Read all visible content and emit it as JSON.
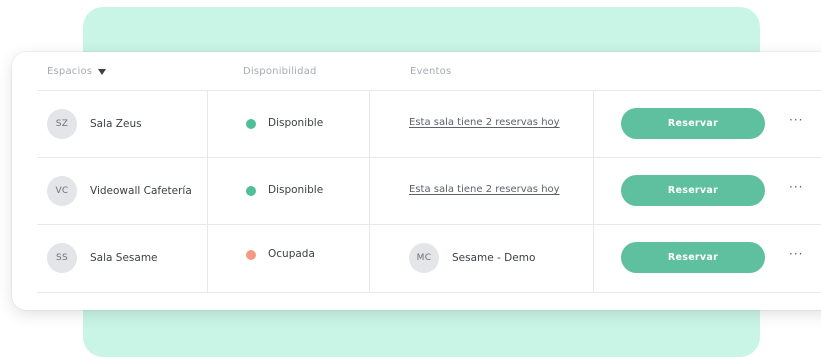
{
  "header": {
    "espacios": "Espacios",
    "disponibilidad": "Disponibilidad",
    "eventos": "Eventos"
  },
  "colors": {
    "accent": "#5ec09e",
    "available_dot": "#4fbf9a",
    "occupied_dot": "#f59a82",
    "background_panel": "#c9f5e6"
  },
  "rows": [
    {
      "initials": "SZ",
      "name": "Sala Zeus",
      "status": "Disponible",
      "status_type": "available",
      "event_link": "Esta sala tiene 2 reservas hoy",
      "button": "Reservar",
      "more": "···"
    },
    {
      "initials": "VC",
      "name": "Videowall Cafetería",
      "status": "Disponible",
      "status_type": "available",
      "event_link": "Esta sala tiene 2 reservas hoy",
      "button": "Reservar",
      "more": "···"
    },
    {
      "initials": "SS",
      "name": "Sala Sesame",
      "status": "Ocupada",
      "status_type": "occupied",
      "event_initials": "MC",
      "event_name": "Sesame - Demo",
      "button": "Reservar",
      "more": "···"
    }
  ]
}
